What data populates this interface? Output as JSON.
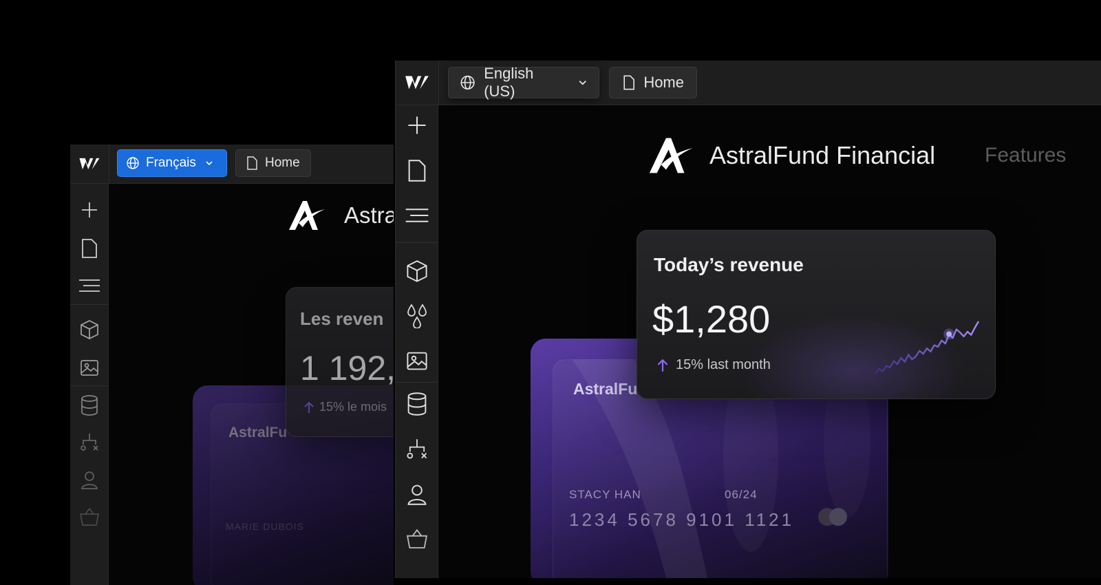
{
  "back_window": {
    "locale": "Français",
    "page": "Home",
    "brand_partial": "Astra",
    "revenue_title_partial": "Les reven",
    "revenue_value_partial": "1 192,",
    "change_partial": "15% le mois",
    "card_brand_partial": "AstralFu",
    "card_holder_partial": "MARIE DUBOIS"
  },
  "front_window": {
    "locale": "English (US)",
    "page": "Home",
    "brand": "AstralFund Financial",
    "nav_partial": "Features",
    "revenue": {
      "title": "Today’s revenue",
      "value": "$1,280",
      "change": "15% last month",
      "sparkline": [
        2,
        8,
        5,
        12,
        10,
        18,
        14,
        22,
        17,
        26,
        20,
        24,
        31,
        27,
        34,
        30,
        38,
        36,
        44,
        40,
        52,
        47,
        58,
        54,
        49,
        55,
        51,
        60,
        68
      ],
      "highlight_index": 20
    },
    "card": {
      "brand_partial": "AstralFu",
      "holder": "STACY HAN",
      "expiry": "06/24",
      "number": "1234 5678 9101 1121"
    }
  },
  "sidebar_icons": [
    "add-icon",
    "pages-icon",
    "navigator-icon",
    "components-icon",
    "variables-icon",
    "assets-icon",
    "cms-icon",
    "logic-icon",
    "users-icon",
    "ecommerce-icon"
  ],
  "colors": {
    "accent_blue": "#1a6bdc",
    "purple": "#8b6cf0",
    "background": "#000000"
  }
}
